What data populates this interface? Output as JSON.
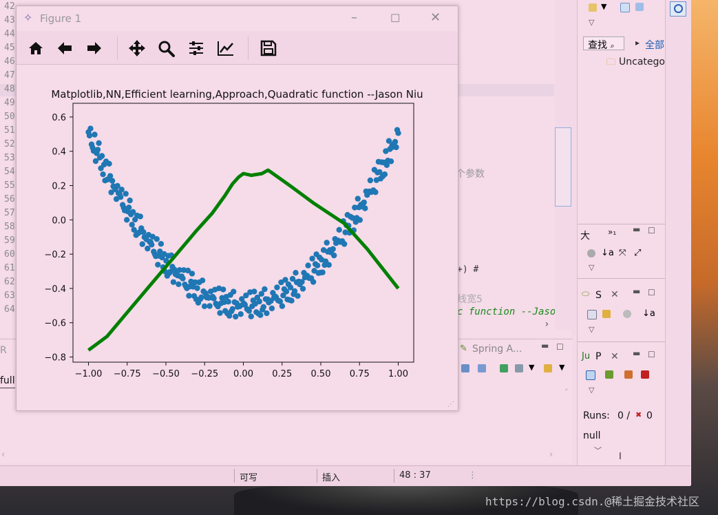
{
  "editor": {
    "line_numbers": [
      "42",
      "43",
      "44",
      "45",
      "46",
      "47",
      "48",
      "49",
      "50",
      "51",
      "52",
      "53",
      "54",
      "55",
      "56",
      "57",
      "58",
      "59",
      "60",
      "61",
      "62",
      "63",
      "64"
    ],
    "frag_param": "个参数",
    "frag_paren": "+) #",
    "frag_line": "线宽5",
    "frag_code": "c function --Jaso"
  },
  "right_panel": {
    "search_label": "查找",
    "all_label": "全部",
    "uncategorized": "Uncatego",
    "outline_tab": "大",
    "outline_tab2": "»₁",
    "servers_tab": "S",
    "junit_tab": "P",
    "runs_label": "Runs:",
    "runs_value": "0 /",
    "errors_value": "0",
    "null_text": "null",
    "cursor_bar": "I"
  },
  "bottom_panel": {
    "tab_r": "R",
    "tab_spring": "Spring A...",
    "full_text": "full"
  },
  "status_bar": {
    "writable": "可写",
    "insert": "插入",
    "position": "48 : 37"
  },
  "watermark": "https://blog.csdn.@稀土掘金技术社区",
  "figure_window": {
    "title": "Figure 1",
    "toolbar": [
      "home",
      "back",
      "forward",
      "pan",
      "zoom",
      "configure",
      "edit-axes",
      "save"
    ]
  },
  "chart_data": {
    "type": "scatter",
    "title": "Matplotlib,NN,Efficient learning,Approach,Quadratic function --Jason Niu",
    "xlim": [
      -1.1,
      1.1
    ],
    "ylim": [
      -0.83,
      0.68
    ],
    "xticks": [
      "−1.00",
      "−0.75",
      "−0.50",
      "−0.25",
      "0.00",
      "0.25",
      "0.50",
      "0.75",
      "1.00"
    ],
    "xtick_values": [
      -1.0,
      -0.75,
      -0.5,
      -0.25,
      0.0,
      0.25,
      0.5,
      0.75,
      1.0
    ],
    "yticks": [
      "0.6",
      "0.4",
      "0.2",
      "0.0",
      "−0.2",
      "−0.4",
      "−0.6",
      "−0.8"
    ],
    "ytick_values": [
      0.6,
      0.4,
      0.2,
      0.0,
      -0.2,
      -0.4,
      -0.6,
      -0.8
    ],
    "scatter_color": "#1f77b4",
    "line_color": "#008000",
    "line": {
      "x": [
        -1.0,
        -0.88,
        -0.75,
        -0.6,
        -0.45,
        -0.3,
        -0.2,
        -0.12,
        -0.07,
        -0.03,
        0.0,
        0.05,
        0.12,
        0.16,
        0.3,
        0.45,
        0.55,
        0.65,
        0.8,
        1.0
      ],
      "y": [
        -0.76,
        -0.68,
        -0.54,
        -0.38,
        -0.22,
        -0.06,
        0.04,
        0.14,
        0.21,
        0.25,
        0.27,
        0.26,
        0.27,
        0.29,
        0.2,
        0.1,
        0.04,
        -0.02,
        -0.17,
        -0.4
      ]
    },
    "noise_points": [
      0.03,
      -0.04,
      0.05,
      -0.02,
      0.01,
      -0.05,
      0.04,
      -0.03,
      0.02,
      -0.01,
      0.05,
      -0.04,
      0.0,
      0.03,
      -0.02,
      0.04,
      -0.05,
      0.01,
      -0.03,
      0.02,
      0.05,
      -0.01,
      -0.04,
      0.03,
      0.0,
      -0.02,
      0.04,
      -0.05,
      0.02,
      -0.03
    ],
    "scatter_count": 300
  }
}
